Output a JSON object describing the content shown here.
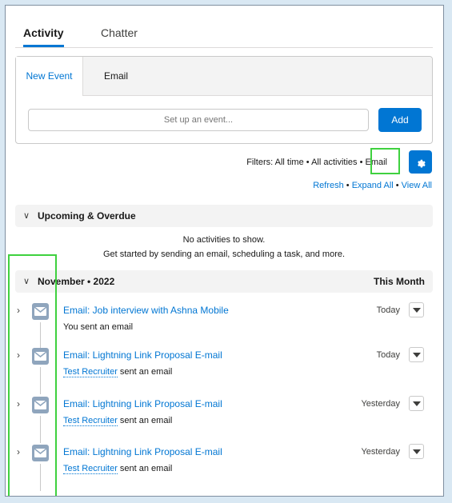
{
  "tabs": {
    "activity": "Activity",
    "chatter": "Chatter"
  },
  "composer": {
    "new_event_tab": "New Event",
    "email_tab": "Email",
    "input_placeholder": "Set up an event...",
    "add_label": "Add"
  },
  "filters": {
    "text": "Filters: All time • All activities • Email",
    "gear_icon": "gear-icon"
  },
  "links": {
    "refresh": "Refresh",
    "sep": " • ",
    "expand_all": "Expand All",
    "view_all": "View All"
  },
  "upcoming": {
    "title": "Upcoming & Overdue",
    "empty_line1": "No activities to show.",
    "empty_line2": "Get started by sending an email, scheduling a task, and more."
  },
  "month": {
    "title": "November • 2022",
    "right_label": "This Month"
  },
  "items": [
    {
      "subject": "Email: Job interview with Ashna Mobile",
      "date": "Today",
      "desc_text": "You sent an email",
      "person": ""
    },
    {
      "subject": "Email: Lightning Link Proposal E-mail",
      "date": "Today",
      "desc_text": " sent an email",
      "person": "Test Recruiter"
    },
    {
      "subject": "Email: Lightning Link Proposal E-mail",
      "date": "Yesterday",
      "desc_text": " sent an email",
      "person": "Test Recruiter"
    },
    {
      "subject": "Email: Lightning Link Proposal E-mail",
      "date": "Yesterday",
      "desc_text": " sent an email",
      "person": "Test Recruiter"
    }
  ],
  "colors": {
    "accent": "#0176d3",
    "highlight": "#3fd13f",
    "email_icon_bg": "#8fa5bd"
  }
}
